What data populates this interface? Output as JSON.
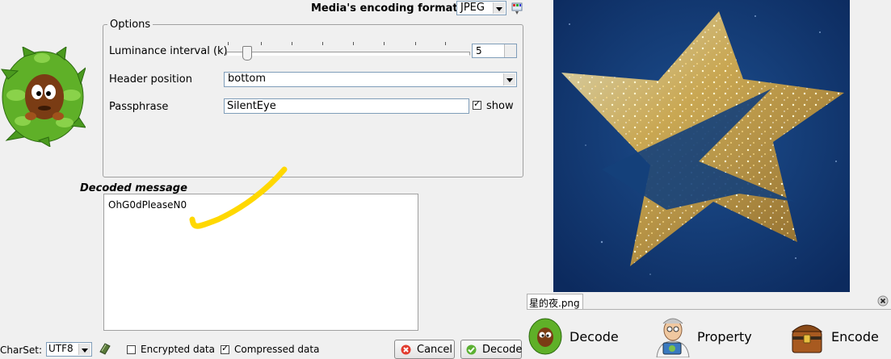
{
  "format": {
    "label": "Media's encoding format :",
    "value": "JPEG"
  },
  "options": {
    "legend": "Options",
    "luminance_label": "Luminance interval (k)",
    "luminance_value": "5",
    "header_label": "Header position",
    "header_value": "bottom",
    "passphrase_label": "Passphrase",
    "passphrase_value": "SilentEye",
    "show_label": "show"
  },
  "decoded": {
    "title": "Decoded message",
    "message": "OhG0dPleaseN0"
  },
  "footer": {
    "charset_label": "CharSet:",
    "charset_value": "UTF8",
    "encrypted_label": "Encrypted data",
    "compressed_label": "Compressed data",
    "cancel_label": "Cancel",
    "decode_label": "Decode"
  },
  "file_tab": "星的夜.png",
  "actions": {
    "decode": "Decode",
    "property": "Property",
    "encode": "Encode"
  }
}
